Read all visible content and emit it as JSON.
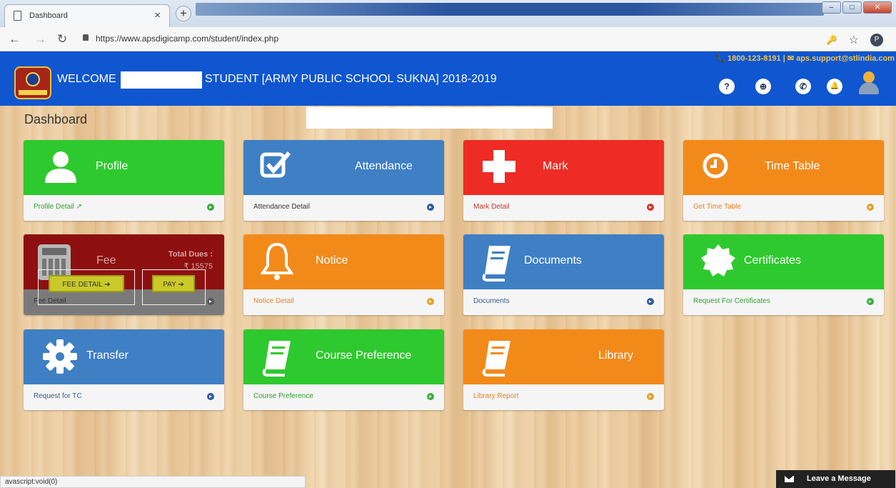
{
  "browser": {
    "tab_title": "Dashboard",
    "tab_close": "×",
    "new_tab": "+",
    "url": "https://www.apsdigicamp.com/student/index.php",
    "profile_initial": "P",
    "window_min": "–",
    "window_max": "□",
    "window_close": "✕"
  },
  "header": {
    "welcome_prefix": "WELCOME",
    "welcome_suffix": "STUDENT [ARMY PUBLIC SCHOOL SUKNA] 2018-2019",
    "contact": "📞 1800-123-8191 | ✉ aps.support@stlindia.com",
    "icons": [
      "?",
      "⊕",
      "✆",
      "🔔"
    ]
  },
  "page_title": "Dashboard",
  "tiles": [
    {
      "name": "profile",
      "title": "Profile",
      "link": "Profile Detail ↗",
      "color": "#2ec92e"
    },
    {
      "name": "attendance",
      "title": "Attendance",
      "link": "Attendance Detail",
      "color": "#3f7fc4"
    },
    {
      "name": "mark",
      "title": "Mark",
      "link": "Mark Detail",
      "color": "#ee2b25"
    },
    {
      "name": "time-table",
      "title": "Time Table",
      "link": "Get Time Table",
      "color": "#f28a1a"
    },
    {
      "name": "notice",
      "title": "Notice",
      "link": "Notice Detail",
      "color": "#f28a1a"
    },
    {
      "name": "documents",
      "title": "Documents",
      "link": "Documents",
      "color": "#3f7fc4"
    },
    {
      "name": "certificates",
      "title": "Certificates",
      "link": "Request For Certificates",
      "color": "#2ec92e"
    },
    {
      "name": "transfer",
      "title": "Transfer",
      "link": "Request for TC",
      "color": "#3f7fc4"
    },
    {
      "name": "course-preference",
      "title": "Course Preference",
      "link": "Course Preference",
      "color": "#2ec92e"
    },
    {
      "name": "library",
      "title": "Library",
      "link": "Library Report",
      "color": "#f28a1a"
    }
  ],
  "fee": {
    "title": "Fee",
    "dues_label": "Total Dues :",
    "dues_amount": "₹ 15575",
    "detail_button": "FEE DETAIL ➔",
    "pay_button": "PAY ➔",
    "link": "Fee Detail"
  },
  "status_bar": "avascript:void(0)",
  "chat": {
    "label": "Leave a Message"
  }
}
